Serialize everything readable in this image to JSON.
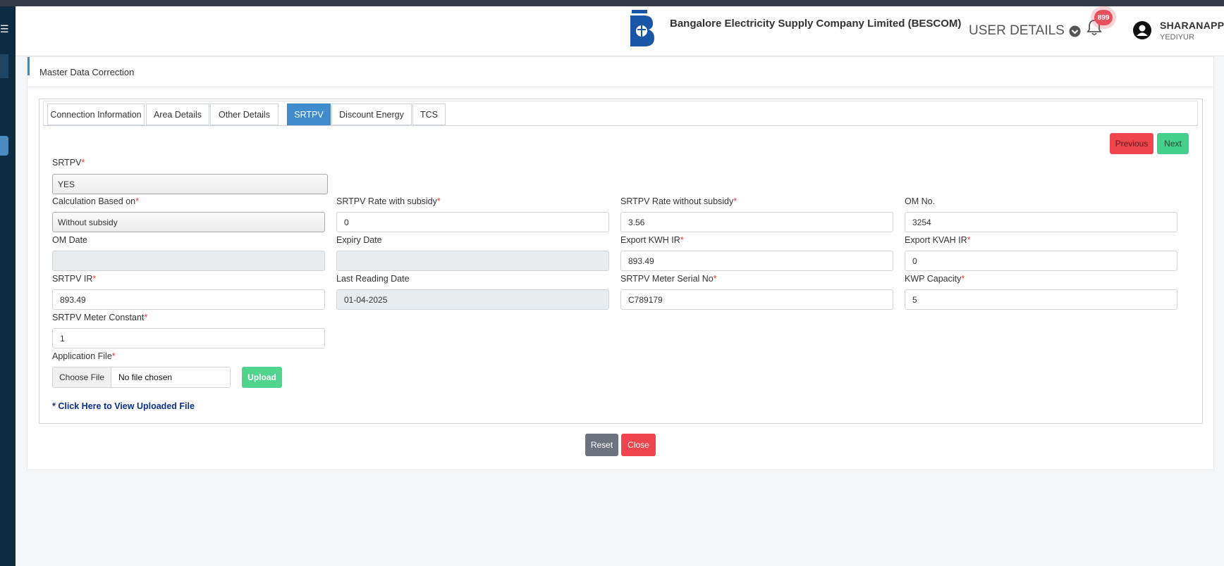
{
  "header": {
    "company": "Bangalore Electricity Supply Company Limited (BESCOM)",
    "user_details": "USER DETAILS",
    "notification_count": "899",
    "user_name": "SHARANAPPA",
    "user_location": "YEDIYUR"
  },
  "page": {
    "title": "Master Data Correction"
  },
  "tabs": [
    {
      "label": "Connection Information"
    },
    {
      "label": "Area Details"
    },
    {
      "label": "Other Details"
    },
    {
      "label": "SRTPV",
      "active": true
    },
    {
      "label": "Discount Energy"
    },
    {
      "label": "TCS"
    }
  ],
  "nav": {
    "previous": "Previous",
    "next": "Next"
  },
  "form": {
    "srtpv": {
      "label": "SRTPV",
      "value": "YES"
    },
    "calc_based": {
      "label": "Calculation Based on",
      "value": "Without subsidy"
    },
    "rate_with": {
      "label": "SRTPV Rate with subsidy",
      "value": "0"
    },
    "rate_without": {
      "label": "SRTPV Rate without subsidy",
      "value": "3.56"
    },
    "om_no": {
      "label": "OM No.",
      "value": "3254"
    },
    "om_date": {
      "label": "OM Date",
      "value": ""
    },
    "expiry_date": {
      "label": "Expiry Date",
      "value": ""
    },
    "export_kwh": {
      "label": "Export KWH IR",
      "value": "893.49"
    },
    "export_kvah": {
      "label": "Export KVAH IR",
      "value": "0"
    },
    "srtpv_ir": {
      "label": "SRTPV IR",
      "value": "893.49"
    },
    "last_reading": {
      "label": "Last Reading Date",
      "value": "01-04-2025"
    },
    "meter_serial": {
      "label": "SRTPV Meter Serial No",
      "value": "C789179"
    },
    "kwp": {
      "label": "KWP Capacity",
      "value": "5"
    },
    "meter_constant": {
      "label": "SRTPV Meter Constant",
      "value": "1"
    },
    "app_file": {
      "label": "Application File",
      "choose": "Choose File",
      "status": "No file chosen"
    },
    "upload": "Upload",
    "view_link": "* Click Here to View Uploaded File",
    "required_mark": "*"
  },
  "footer": {
    "reset": "Reset",
    "close": "Close"
  },
  "colors": {
    "primary_tab": "#3f8ccc",
    "danger": "#f0454c",
    "success": "#45d08a",
    "sidebar": "#0d2c44"
  }
}
